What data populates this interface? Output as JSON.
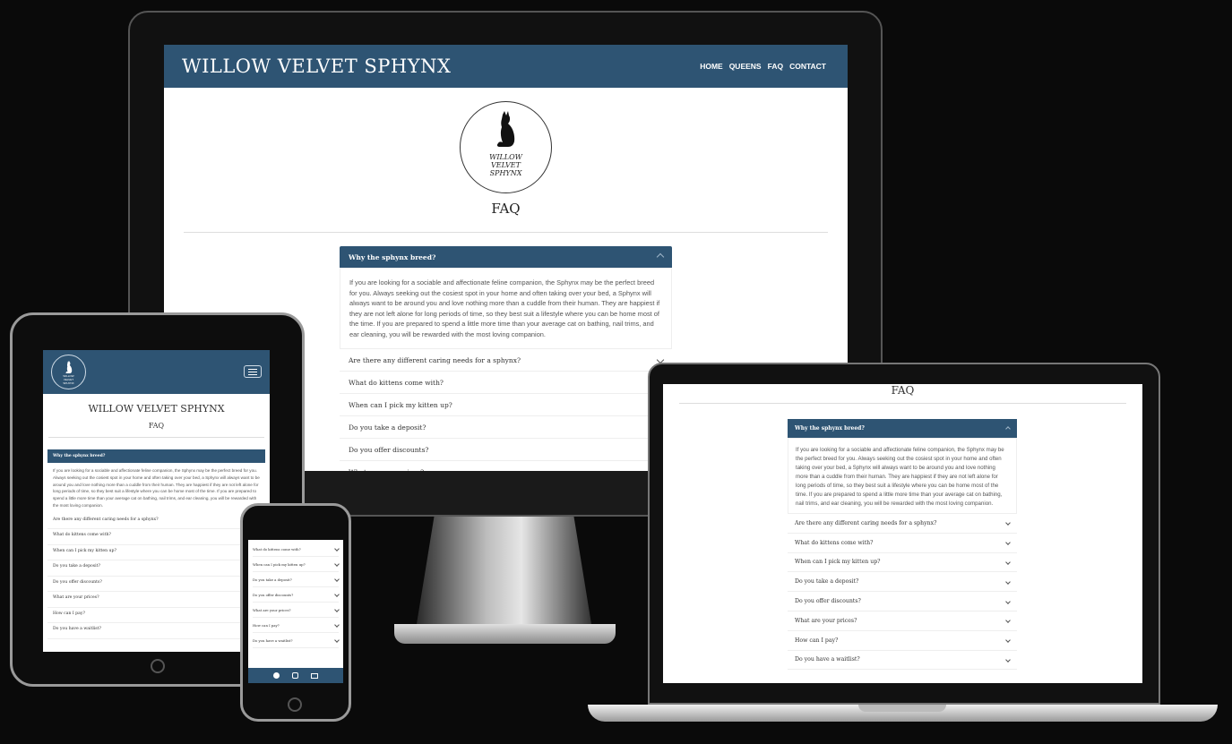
{
  "site": {
    "brand": "WILLOW VELVET SPHYNX",
    "logo_text": [
      "WILLOW",
      "VELVET",
      "SPHYNX"
    ],
    "nav": [
      "HOME",
      "QUEENS",
      "FAQ",
      "CONTACT"
    ],
    "page_title": "FAQ"
  },
  "faq": {
    "open_question": "Why the sphynx breed?",
    "open_answer": "If you are looking for a sociable and affectionate feline companion, the Sphynx may be the perfect breed for you. Always seeking out the cosiest spot in your home and often taking over your bed, a Sphynx will always want to be around you and love nothing more than a cuddle from their human. They are happiest if they are not left alone for long periods of time, so they best suit a lifestyle where you can be home most of the time. If you are prepared to spend a little more time than your average cat on bathing, nail trims, and ear cleaning, you will be rewarded with the most loving companion.",
    "questions": [
      "Are there any different caring needs for a sphynx?",
      "What do kittens come with?",
      "When can I pick my kitten up?",
      "Do you take a deposit?",
      "Do you offer discounts?",
      "What are your prices?",
      "How can I pay?",
      "Do you have a waitlist?"
    ]
  },
  "colors": {
    "header": "#2e5473",
    "background": "#0a0a0a"
  },
  "icons": [
    "menu-icon",
    "facebook-icon",
    "instagram-icon",
    "email-icon",
    "chevron-down-icon",
    "chevron-up-icon",
    "cat-logo-icon"
  ]
}
